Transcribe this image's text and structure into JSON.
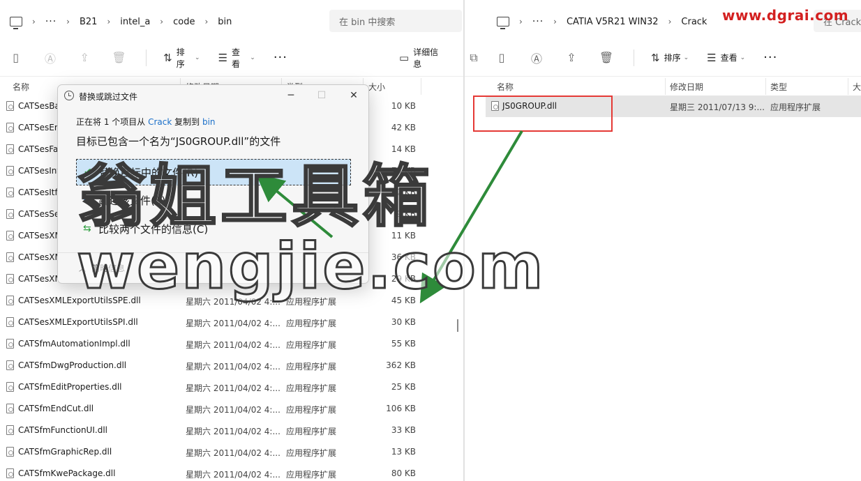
{
  "watermark": {
    "site": "www.dgrai.com",
    "cn": "翁姐工具箱",
    "en": "wengjie.com"
  },
  "left_pane": {
    "breadcrumb": [
      "B21",
      "intel_a",
      "code",
      "bin"
    ],
    "search_placeholder": "在 bin 中搜索",
    "toolbar": {
      "sort": "排序",
      "view": "查看",
      "details": "详细信息"
    },
    "columns": {
      "name": "名称",
      "date": "修改日期",
      "type": "类型",
      "size": "大小"
    },
    "files": [
      {
        "name": "CATSesBa",
        "date": "",
        "type": "",
        "size": "10 KB"
      },
      {
        "name": "CATSesEn",
        "date": "",
        "type": "",
        "size": "42 KB"
      },
      {
        "name": "CATSesFa",
        "date": "",
        "type": "",
        "size": "14 KB"
      },
      {
        "name": "CATSesInt",
        "date": "",
        "type": "",
        "size": "73 KB"
      },
      {
        "name": "CATSesItf",
        "date": "",
        "type": "",
        "size": "12 KB"
      },
      {
        "name": "CATSesSe",
        "date": "",
        "type": "",
        "size": "9 KB"
      },
      {
        "name": "CATSesXM",
        "date": "",
        "type": "",
        "size": "11 KB"
      },
      {
        "name": "CATSesXM",
        "date": "",
        "type": "",
        "size": "36 KB"
      },
      {
        "name": "CATSesXM",
        "date": "",
        "type": "",
        "size": "29 KB"
      },
      {
        "name": "CATSesXMLExportUtilsSPE.dll",
        "date": "星期六 2011/04/02 4:...",
        "type": "应用程序扩展",
        "size": "45 KB"
      },
      {
        "name": "CATSesXMLExportUtilsSPI.dll",
        "date": "星期六 2011/04/02 4:...",
        "type": "应用程序扩展",
        "size": "30 KB"
      },
      {
        "name": "CATSfmAutomationImpl.dll",
        "date": "星期六 2011/04/02 4:...",
        "type": "应用程序扩展",
        "size": "55 KB"
      },
      {
        "name": "CATSfmDwgProduction.dll",
        "date": "星期六 2011/04/02 4:...",
        "type": "应用程序扩展",
        "size": "362 KB"
      },
      {
        "name": "CATSfmEditProperties.dll",
        "date": "星期六 2011/04/02 4:...",
        "type": "应用程序扩展",
        "size": "25 KB"
      },
      {
        "name": "CATSfmEndCut.dll",
        "date": "星期六 2011/04/02 4:...",
        "type": "应用程序扩展",
        "size": "106 KB"
      },
      {
        "name": "CATSfmFunctionUI.dll",
        "date": "星期六 2011/04/02 4:...",
        "type": "应用程序扩展",
        "size": "33 KB"
      },
      {
        "name": "CATSfmGraphicRep.dll",
        "date": "星期六 2011/04/02 4:...",
        "type": "应用程序扩展",
        "size": "13 KB"
      },
      {
        "name": "CATSfmKwePackage.dll",
        "date": "星期六 2011/04/02 4:...",
        "type": "应用程序扩展",
        "size": "80 KB"
      }
    ]
  },
  "right_pane": {
    "breadcrumb": [
      "CATIA V5R21 WIN32",
      "Crack"
    ],
    "search_placeholder": "在 Crack",
    "toolbar": {
      "sort": "排序",
      "view": "查看"
    },
    "columns": {
      "name": "名称",
      "date": "修改日期",
      "type": "类型",
      "size": "大"
    },
    "files": [
      {
        "name": "JS0GROUP.dll",
        "date": "星期三 2011/07/13 9:...",
        "type": "应用程序扩展"
      }
    ]
  },
  "dialog": {
    "title": "替换或跳过文件",
    "line1_prefix": "正在将 1 个项目从",
    "line1_src": "Crack",
    "line1_mid": "复制到",
    "line1_dst": "bin",
    "heading": "目标已包含一个名为“JS0GROUP.dll”的文件",
    "option_replace": "替换目标中的文件(R)",
    "option_skip": "跳过该文件(S)",
    "option_compare": "比较两个文件的信息(C)",
    "footer": "简略信息"
  },
  "colors": {
    "accent_link": "#1a6fc9",
    "highlight": "#cce4f7",
    "red_box": "#e53935",
    "arrow": "#2e8b3a"
  }
}
